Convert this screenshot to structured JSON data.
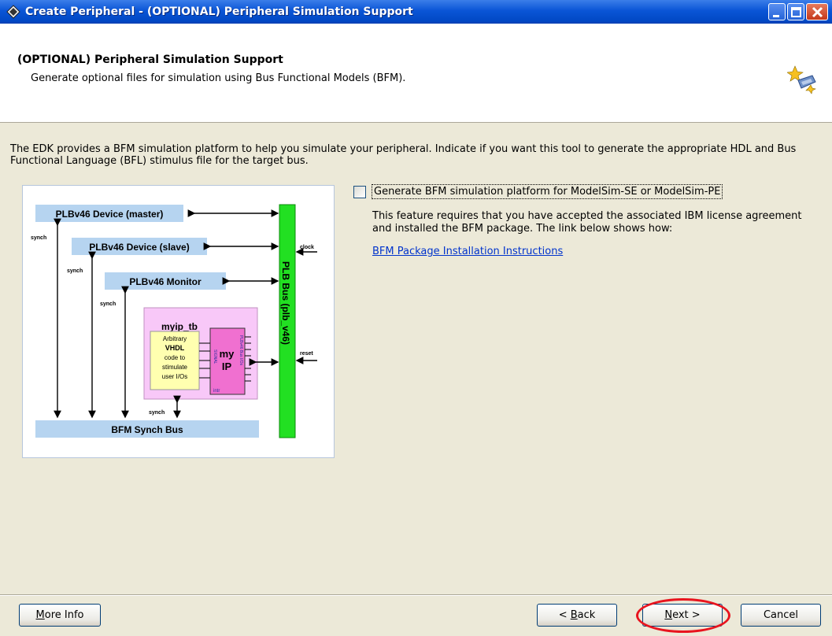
{
  "window": {
    "title": "Create Peripheral - (OPTIONAL) Peripheral Simulation Support"
  },
  "header": {
    "title": "(OPTIONAL) Peripheral Simulation Support",
    "subtitle": "Generate optional files for simulation using Bus Functional Models (BFM)."
  },
  "description": "The EDK provides a BFM simulation platform to help you simulate your peripheral. Indicate if you want this tool to generate the appropriate HDL and Bus Functional Language (BFL) stimulus file for the target bus.",
  "diagram": {
    "master": "PLBv46 Device (master)",
    "slave": "PLBv46 Device (slave)",
    "monitor": "PLBv46 Monitor",
    "synch_bus": "BFM Synch Bus",
    "plb_bus": "PLB Bus (plb_v46)",
    "myip_tb": "myip_tb",
    "arbitrary_lines": [
      "Arbitrary",
      "VHDL",
      "code to",
      "stimulate",
      "user I/Os"
    ],
    "my_ip_lines": [
      "my",
      "IP"
    ],
    "plb_if": "PLBv46 Bus I/Os",
    "sig_label": "SIGNAL",
    "intr": "intr",
    "synch": "synch",
    "clock": "clock",
    "reset": "reset"
  },
  "options": {
    "generate_bfm_label": "Generate BFM simulation platform for ModelSim-SE or ModelSim-PE",
    "generate_bfm_checked": false,
    "note": "This feature requires that you have accepted the associated IBM license agreement and installed the BFM package. The link below shows how:",
    "link": "BFM Package Installation Instructions"
  },
  "buttons": {
    "more_info_m": "M",
    "more_info_rest": "ore Info",
    "back_pre": "< ",
    "back_m": "B",
    "back_rest": "ack",
    "next_m": "N",
    "next_rest": "ext >",
    "cancel": "Cancel"
  }
}
